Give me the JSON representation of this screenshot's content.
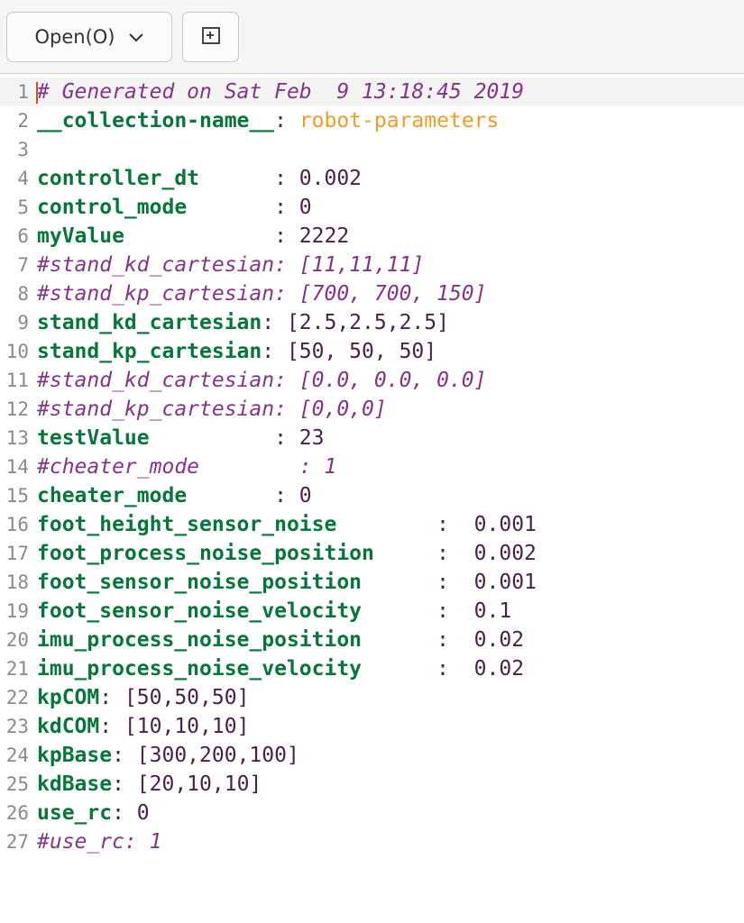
{
  "toolbar": {
    "open_label": "Open(O)",
    "open_dropdown_icon": "chevron-down-icon",
    "new_tab_icon": "new-document-icon"
  },
  "editor": {
    "lines": [
      {
        "num": "1",
        "parts": [
          {
            "cls": "c",
            "text": "# Generated on Sat Feb  9 13:18:45 2019"
          }
        ]
      },
      {
        "num": "2",
        "parts": [
          {
            "cls": "k",
            "text": "__collection-name__"
          },
          {
            "cls": "v",
            "text": ": "
          },
          {
            "cls": "s",
            "text": "robot-parameters"
          }
        ]
      },
      {
        "num": "3",
        "parts": []
      },
      {
        "num": "4",
        "parts": [
          {
            "cls": "k",
            "text": "controller_dt"
          },
          {
            "cls": "v",
            "text": "      : 0.002"
          }
        ]
      },
      {
        "num": "5",
        "parts": [
          {
            "cls": "k",
            "text": "control_mode"
          },
          {
            "cls": "v",
            "text": "       : 0"
          }
        ]
      },
      {
        "num": "6",
        "parts": [
          {
            "cls": "k",
            "text": "myValue"
          },
          {
            "cls": "v",
            "text": "            : 2222"
          }
        ]
      },
      {
        "num": "7",
        "parts": [
          {
            "cls": "c",
            "text": "#stand_kd_cartesian: [11,11,11]"
          }
        ]
      },
      {
        "num": "8",
        "parts": [
          {
            "cls": "c",
            "text": "#stand_kp_cartesian: [700, 700, 150]"
          }
        ]
      },
      {
        "num": "9",
        "parts": [
          {
            "cls": "k",
            "text": "stand_kd_cartesian"
          },
          {
            "cls": "v",
            "text": ": [2.5,2.5,2.5]"
          }
        ]
      },
      {
        "num": "10",
        "parts": [
          {
            "cls": "k",
            "text": "stand_kp_cartesian"
          },
          {
            "cls": "v",
            "text": ": [50, 50, 50]"
          }
        ]
      },
      {
        "num": "11",
        "parts": [
          {
            "cls": "c",
            "text": "#stand_kd_cartesian: [0.0, 0.0, 0.0]"
          }
        ]
      },
      {
        "num": "12",
        "parts": [
          {
            "cls": "c",
            "text": "#stand_kp_cartesian: [0,0,0]"
          }
        ]
      },
      {
        "num": "13",
        "parts": [
          {
            "cls": "k",
            "text": "testValue"
          },
          {
            "cls": "v",
            "text": "          : 23"
          }
        ]
      },
      {
        "num": "14",
        "parts": [
          {
            "cls": "c",
            "text": "#cheater_mode        : 1"
          }
        ]
      },
      {
        "num": "15",
        "parts": [
          {
            "cls": "k",
            "text": "cheater_mode"
          },
          {
            "cls": "v",
            "text": "       : 0"
          }
        ]
      },
      {
        "num": "16",
        "parts": [
          {
            "cls": "k",
            "text": "foot_height_sensor_noise"
          },
          {
            "cls": "v",
            "text": "        :  0.001"
          }
        ]
      },
      {
        "num": "17",
        "parts": [
          {
            "cls": "k",
            "text": "foot_process_noise_position"
          },
          {
            "cls": "v",
            "text": "     :  0.002"
          }
        ]
      },
      {
        "num": "18",
        "parts": [
          {
            "cls": "k",
            "text": "foot_sensor_noise_position"
          },
          {
            "cls": "v",
            "text": "      :  0.001"
          }
        ]
      },
      {
        "num": "19",
        "parts": [
          {
            "cls": "k",
            "text": "foot_sensor_noise_velocity"
          },
          {
            "cls": "v",
            "text": "      :  0.1"
          }
        ]
      },
      {
        "num": "20",
        "parts": [
          {
            "cls": "k",
            "text": "imu_process_noise_position"
          },
          {
            "cls": "v",
            "text": "      :  0.02"
          }
        ]
      },
      {
        "num": "21",
        "parts": [
          {
            "cls": "k",
            "text": "imu_process_noise_velocity"
          },
          {
            "cls": "v",
            "text": "      :  0.02"
          }
        ]
      },
      {
        "num": "22",
        "parts": [
          {
            "cls": "k",
            "text": "kpCOM"
          },
          {
            "cls": "v",
            "text": ": [50,50,50]"
          }
        ]
      },
      {
        "num": "23",
        "parts": [
          {
            "cls": "k",
            "text": "kdCOM"
          },
          {
            "cls": "v",
            "text": ": [10,10,10]"
          }
        ]
      },
      {
        "num": "24",
        "parts": [
          {
            "cls": "k",
            "text": "kpBase"
          },
          {
            "cls": "v",
            "text": ": [300,200,100]"
          }
        ]
      },
      {
        "num": "25",
        "parts": [
          {
            "cls": "k",
            "text": "kdBase"
          },
          {
            "cls": "v",
            "text": ": [20,10,10]"
          }
        ]
      },
      {
        "num": "26",
        "parts": [
          {
            "cls": "k",
            "text": "use_rc"
          },
          {
            "cls": "v",
            "text": ": 0"
          }
        ]
      },
      {
        "num": "27",
        "parts": [
          {
            "cls": "c",
            "text": "#use_rc: 1"
          }
        ]
      }
    ]
  },
  "colors": {
    "key": "#06763a",
    "value": "#4a1f4a",
    "comment": "#86338a",
    "string": "#f39b25",
    "line_number": "#8a8a8a"
  }
}
